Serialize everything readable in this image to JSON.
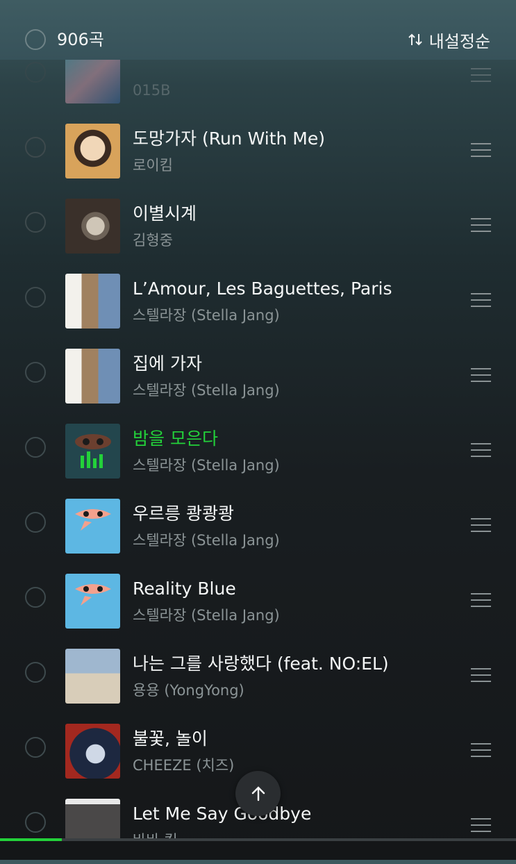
{
  "header": {
    "count_text": "906곡",
    "sort_label": "내설정순",
    "sort_icon": "sort-arrows-icon"
  },
  "songs": [
    {
      "title": "",
      "artist": "015B"
    },
    {
      "title": "도망가자 (Run With Me)",
      "artist": "로이킴"
    },
    {
      "title": "이별시계",
      "artist": "김형중"
    },
    {
      "title": "L’Amour, Les Baguettes, Paris",
      "artist": "스텔라장 (Stella Jang)"
    },
    {
      "title": "집에 가자",
      "artist": "스텔라장 (Stella Jang)"
    },
    {
      "title": "밤을 모은다",
      "artist": "스텔라장 (Stella Jang)",
      "playing": true
    },
    {
      "title": "우르릉 쾅쾅쾅",
      "artist": "스텔라장 (Stella Jang)"
    },
    {
      "title": "Reality Blue",
      "artist": "스텔라장 (Stella Jang)"
    },
    {
      "title": "나는 그를 사랑했다 (feat. NO:EL)",
      "artist": "용용 (YongYong)"
    },
    {
      "title": "불꽃, 놀이",
      "artist": "CHEEZE (치즈)"
    },
    {
      "title": "Let Me Say Goodbye",
      "artist": "바바 킴"
    }
  ],
  "playback": {
    "progress": 0.12,
    "accent_color": "#23d13a"
  },
  "scroll_top_icon": "arrow-up-icon"
}
